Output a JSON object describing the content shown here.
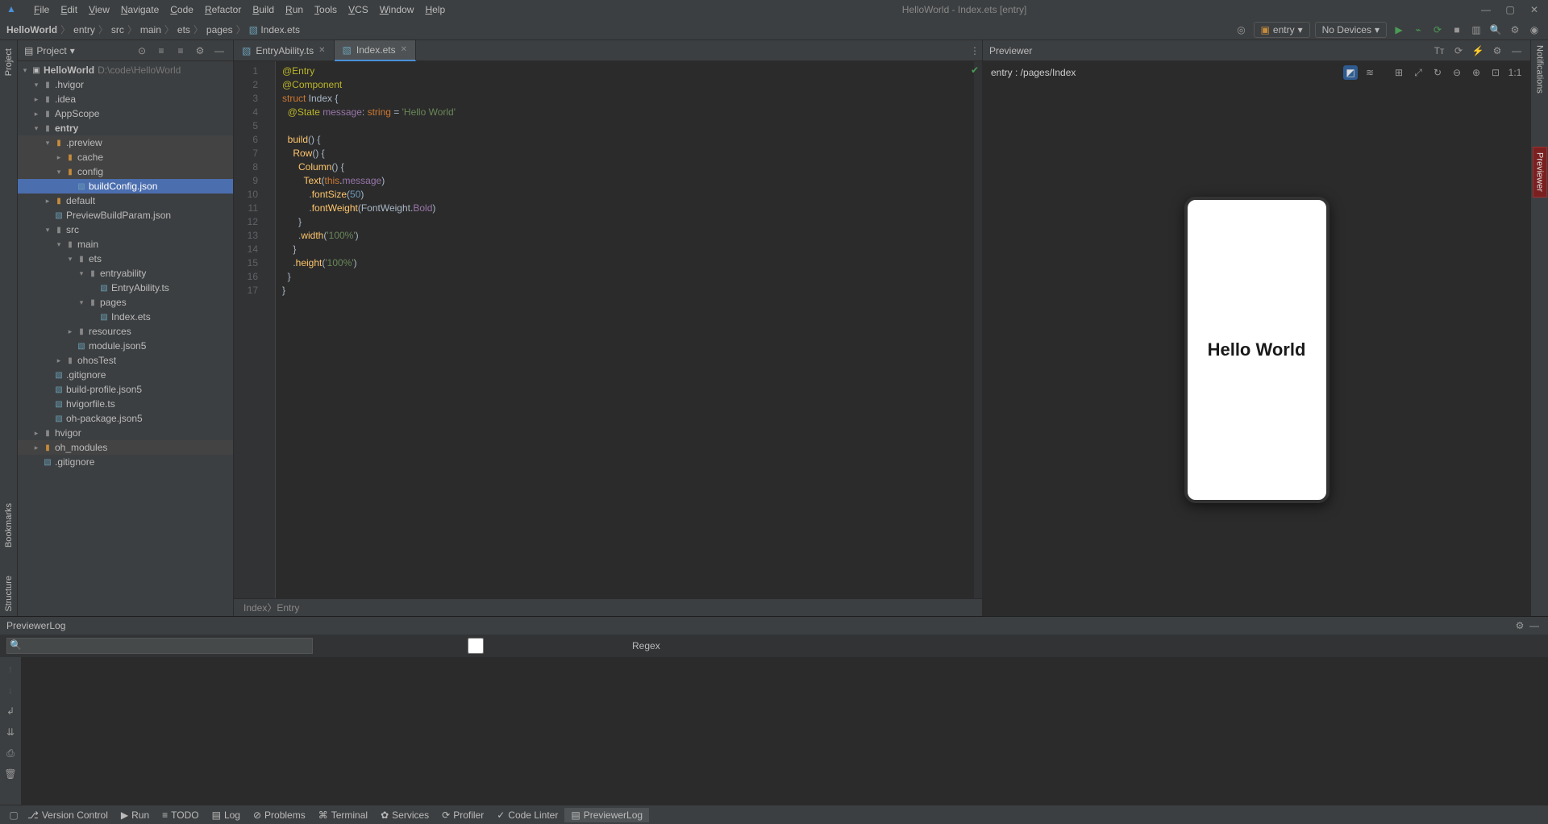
{
  "titlebar": {
    "menus": [
      "File",
      "Edit",
      "View",
      "Navigate",
      "Code",
      "Refactor",
      "Build",
      "Run",
      "Tools",
      "VCS",
      "Window",
      "Help"
    ],
    "title": "HelloWorld - Index.ets [entry]"
  },
  "breadcrumbs": [
    "HelloWorld",
    "entry",
    "src",
    "main",
    "ets",
    "pages",
    "Index.ets"
  ],
  "run": {
    "config": "entry",
    "devices": "No Devices"
  },
  "project_panel": {
    "title": "Project",
    "root": {
      "name": "HelloWorld",
      "path": "D:\\code\\HelloWorld"
    },
    "tree": [
      {
        "d": 1,
        "a": "▾",
        "ic": "folder-grey",
        "lbl": ".hvigor"
      },
      {
        "d": 1,
        "a": "▸",
        "ic": "folder-grey",
        "lbl": ".idea"
      },
      {
        "d": 1,
        "a": "▸",
        "ic": "folder-grey",
        "lbl": "AppScope"
      },
      {
        "d": 1,
        "a": "▾",
        "ic": "folder-grey",
        "lbl": "entry",
        "bold": true
      },
      {
        "d": 2,
        "a": "▾",
        "ic": "folder-orange",
        "lbl": ".preview",
        "hl": true
      },
      {
        "d": 3,
        "a": "▸",
        "ic": "folder-orange",
        "lbl": "cache",
        "hl": true
      },
      {
        "d": 3,
        "a": "▾",
        "ic": "folder-orange",
        "lbl": "config",
        "hl": true
      },
      {
        "d": 4,
        "a": " ",
        "ic": "file-blue",
        "lbl": "buildConfig.json",
        "sel": true
      },
      {
        "d": 2,
        "a": "▸",
        "ic": "folder-orange",
        "lbl": "default"
      },
      {
        "d": 2,
        "a": " ",
        "ic": "file-blue",
        "lbl": "PreviewBuildParam.json"
      },
      {
        "d": 2,
        "a": "▾",
        "ic": "folder-grey",
        "lbl": "src"
      },
      {
        "d": 3,
        "a": "▾",
        "ic": "folder-grey",
        "lbl": "main"
      },
      {
        "d": 4,
        "a": "▾",
        "ic": "folder-grey",
        "lbl": "ets"
      },
      {
        "d": 5,
        "a": "▾",
        "ic": "folder-grey",
        "lbl": "entryability"
      },
      {
        "d": 6,
        "a": " ",
        "ic": "file-blue",
        "lbl": "EntryAbility.ts"
      },
      {
        "d": 5,
        "a": "▾",
        "ic": "folder-grey",
        "lbl": "pages"
      },
      {
        "d": 6,
        "a": " ",
        "ic": "file-blue",
        "lbl": "Index.ets"
      },
      {
        "d": 4,
        "a": "▸",
        "ic": "folder-grey",
        "lbl": "resources"
      },
      {
        "d": 4,
        "a": " ",
        "ic": "file-blue",
        "lbl": "module.json5"
      },
      {
        "d": 3,
        "a": "▸",
        "ic": "folder-grey",
        "lbl": "ohosTest"
      },
      {
        "d": 2,
        "a": " ",
        "ic": "file-blue",
        "lbl": ".gitignore"
      },
      {
        "d": 2,
        "a": " ",
        "ic": "file-blue",
        "lbl": "build-profile.json5"
      },
      {
        "d": 2,
        "a": " ",
        "ic": "file-blue",
        "lbl": "hvigorfile.ts"
      },
      {
        "d": 2,
        "a": " ",
        "ic": "file-blue",
        "lbl": "oh-package.json5"
      },
      {
        "d": 1,
        "a": "▸",
        "ic": "folder-grey",
        "lbl": "hvigor"
      },
      {
        "d": 1,
        "a": "▸",
        "ic": "folder-orange",
        "lbl": "oh_modules",
        "hl": true
      },
      {
        "d": 1,
        "a": " ",
        "ic": "file-blue",
        "lbl": ".gitignore"
      }
    ]
  },
  "editor": {
    "tabs": [
      {
        "name": "EntryAbility.ts",
        "active": false
      },
      {
        "name": "Index.ets",
        "active": true
      }
    ],
    "line_count": 17,
    "code_lines": [
      [
        {
          "t": "@Entry",
          "c": "ann"
        }
      ],
      [
        {
          "t": "@Component",
          "c": "ann"
        }
      ],
      [
        {
          "t": "struct ",
          "c": "kw"
        },
        {
          "t": "Index ",
          "c": "type"
        },
        {
          "t": "{",
          "c": ""
        }
      ],
      [
        {
          "t": "  @State ",
          "c": "ann"
        },
        {
          "t": "message",
          "c": "prop"
        },
        {
          "t": ": ",
          "c": ""
        },
        {
          "t": "string",
          "c": "kw"
        },
        {
          "t": " = ",
          "c": ""
        },
        {
          "t": "'Hello World'",
          "c": "str"
        }
      ],
      [
        {
          "t": "",
          "c": ""
        }
      ],
      [
        {
          "t": "  ",
          "c": ""
        },
        {
          "t": "build",
          "c": "fn"
        },
        {
          "t": "() {",
          "c": ""
        }
      ],
      [
        {
          "t": "    ",
          "c": ""
        },
        {
          "t": "Row",
          "c": "fn"
        },
        {
          "t": "() {",
          "c": ""
        }
      ],
      [
        {
          "t": "      ",
          "c": ""
        },
        {
          "t": "Column",
          "c": "fn"
        },
        {
          "t": "() {",
          "c": ""
        }
      ],
      [
        {
          "t": "        ",
          "c": ""
        },
        {
          "t": "Text",
          "c": "fn"
        },
        {
          "t": "(",
          "c": ""
        },
        {
          "t": "this",
          "c": "kw"
        },
        {
          "t": ".",
          "c": ""
        },
        {
          "t": "message",
          "c": "prop"
        },
        {
          "t": ")",
          "c": ""
        }
      ],
      [
        {
          "t": "          .",
          "c": ""
        },
        {
          "t": "fontSize",
          "c": "fn"
        },
        {
          "t": "(",
          "c": ""
        },
        {
          "t": "50",
          "c": "num"
        },
        {
          "t": ")",
          "c": ""
        }
      ],
      [
        {
          "t": "          .",
          "c": ""
        },
        {
          "t": "fontWeight",
          "c": "fn"
        },
        {
          "t": "(",
          "c": ""
        },
        {
          "t": "FontWeight",
          "c": "type"
        },
        {
          "t": ".",
          "c": ""
        },
        {
          "t": "Bold",
          "c": "prop"
        },
        {
          "t": ")",
          "c": ""
        }
      ],
      [
        {
          "t": "      }",
          "c": ""
        }
      ],
      [
        {
          "t": "      .",
          "c": ""
        },
        {
          "t": "width",
          "c": "fn"
        },
        {
          "t": "(",
          "c": ""
        },
        {
          "t": "'100%'",
          "c": "str"
        },
        {
          "t": ")",
          "c": ""
        }
      ],
      [
        {
          "t": "    }",
          "c": ""
        }
      ],
      [
        {
          "t": "    .",
          "c": ""
        },
        {
          "t": "height",
          "c": "fn"
        },
        {
          "t": "(",
          "c": ""
        },
        {
          "t": "'100%'",
          "c": "str"
        },
        {
          "t": ")",
          "c": ""
        }
      ],
      [
        {
          "t": "  }",
          "c": ""
        }
      ],
      [
        {
          "t": "}",
          "c": ""
        }
      ]
    ],
    "breadcrumb": [
      "Index",
      "Entry"
    ]
  },
  "previewer": {
    "title": "Previewer",
    "entry": "entry : /pages/Index",
    "screen_text": "Hello World"
  },
  "previewer_log": {
    "title": "PreviewerLog",
    "search_placeholder": "",
    "regex": "Regex"
  },
  "bottom_tabs": [
    {
      "icon": "⎇",
      "label": "Version Control"
    },
    {
      "icon": "▶",
      "label": "Run"
    },
    {
      "icon": "≡",
      "label": "TODO"
    },
    {
      "icon": "▤",
      "label": "Log"
    },
    {
      "icon": "⊘",
      "label": "Problems"
    },
    {
      "icon": "⌘",
      "label": "Terminal"
    },
    {
      "icon": "✿",
      "label": "Services"
    },
    {
      "icon": "⟳",
      "label": "Profiler"
    },
    {
      "icon": "✓",
      "label": "Code Linter"
    },
    {
      "icon": "▤",
      "label": "PreviewerLog",
      "active": true
    }
  ],
  "left_tabs": {
    "project": "Project",
    "structure": "Structure",
    "bookmarks": "Bookmarks"
  },
  "right_tabs": {
    "notifications": "Notifications",
    "previewer": "Previewer"
  }
}
